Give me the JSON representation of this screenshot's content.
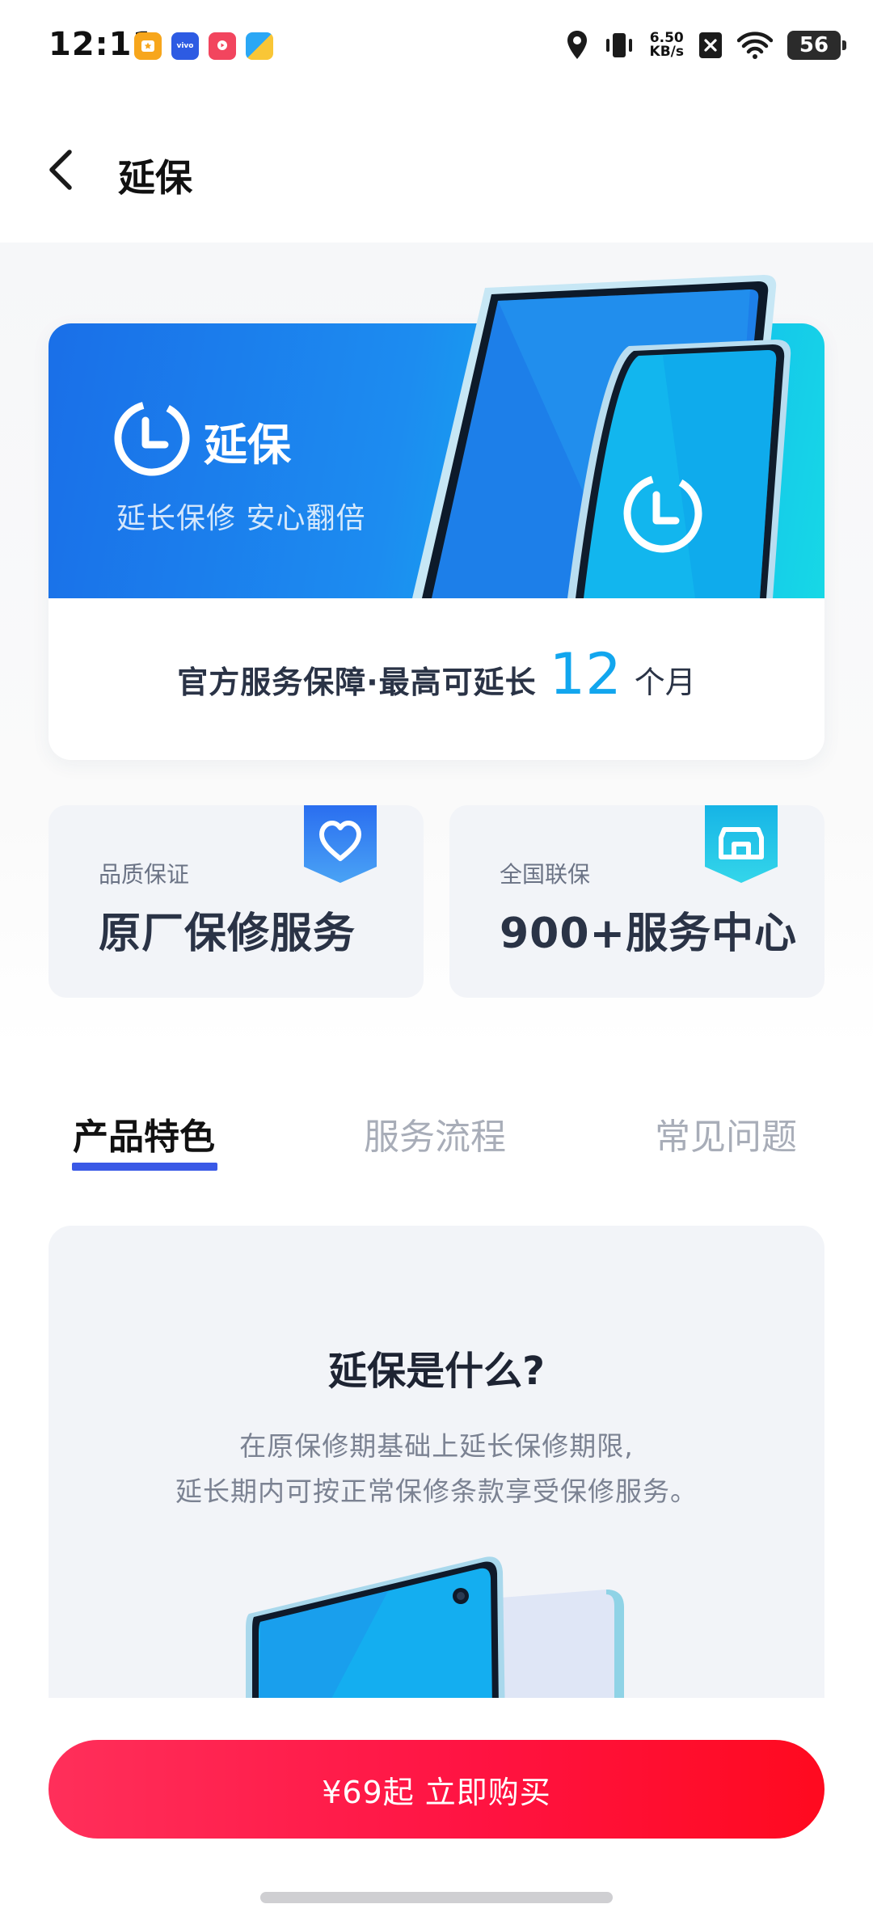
{
  "status_bar": {
    "time": "12:11",
    "net_speed_value": "6.50",
    "net_speed_unit": "KB/s",
    "battery_level": "56"
  },
  "header": {
    "title": "延保"
  },
  "hero": {
    "brand": "延保",
    "slogan": "延长保修 安心翻倍",
    "sub_text": "官方服务保障·最高可延长",
    "sub_number": "12",
    "sub_unit": "个月"
  },
  "features": [
    {
      "small": "品质保证",
      "big": "原厂保修服务",
      "icon": "heart-icon"
    },
    {
      "small": "全国联保",
      "big": "900+服务中心",
      "icon": "store-icon"
    }
  ],
  "tabs": [
    {
      "label": "产品特色",
      "active": true
    },
    {
      "label": "服务流程",
      "active": false
    },
    {
      "label": "常见问题",
      "active": false
    }
  ],
  "panel": {
    "title": "延保是什么?",
    "line1": "在原保修期基础上延长保修期限,",
    "line2": "延长期内可按正常保修条款享受保修服务。"
  },
  "buy": {
    "label": "¥69起 立即购买"
  },
  "colors": {
    "accent_blue": "#12a6ee",
    "tab_indicator": "#3a59e6",
    "buy_red": "#ff1342"
  }
}
